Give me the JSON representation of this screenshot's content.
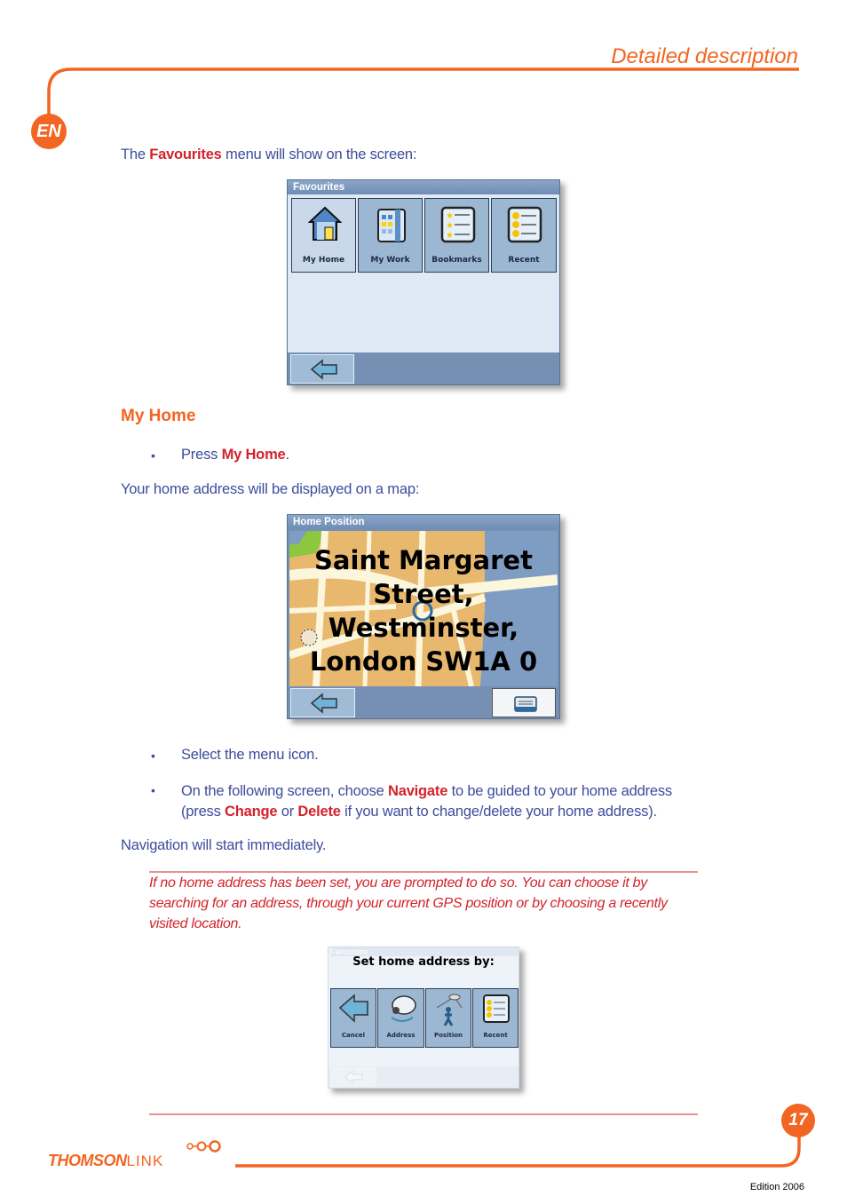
{
  "header": {
    "section_title": "Detailed description",
    "language_badge": "EN"
  },
  "intro": {
    "prefix": "The ",
    "bold": "Favourites",
    "suffix": " menu will show on the screen:"
  },
  "favourites_screen": {
    "title": "Favourites",
    "tiles": [
      {
        "label": "My Home",
        "icon": "house-icon"
      },
      {
        "label": "My Work",
        "icon": "office-building-icon"
      },
      {
        "label": "Bookmarks",
        "icon": "bookmarks-list-icon"
      },
      {
        "label": "Recent",
        "icon": "recent-list-icon"
      }
    ],
    "back_icon": "back-arrow-icon"
  },
  "my_home": {
    "heading": "My Home",
    "bullet1_prefix": "Press ",
    "bullet1_bold": "My Home",
    "bullet1_suffix": ".",
    "map_intro": "Your home address will be displayed on a map:"
  },
  "home_position_screen": {
    "title": "Home Position",
    "address_lines": [
      "Saint Margaret",
      "Street,",
      "Westminster,",
      "London SW1A 0"
    ],
    "back_icon": "back-arrow-icon",
    "menu_icon": "menu-icon",
    "colors": {
      "land": "#e8b86e",
      "water": "#7f9cc3",
      "road": "#fbf6dc",
      "park": "#8dc63f"
    }
  },
  "steps": {
    "bullet2": "Select the menu icon.",
    "bullet3_part1": "On the following screen, choose ",
    "bullet3_bold1": "Navigate",
    "bullet3_part2": " to be guided to your home address",
    "bullet3_part3": "(press ",
    "bullet3_bold2": "Change",
    "bullet3_part4": " or ",
    "bullet3_bold3": "Delete",
    "bullet3_part5": " if you want to change/delete your home address).",
    "after": "Navigation will start immediately."
  },
  "note": {
    "text": "If no home address has been set, you are prompted to do so. You can choose it by searching for an address, through your current GPS position or by choosing a recently visited location."
  },
  "set_home_screen": {
    "faded_title": "Favourites",
    "prompt": "Set home address by:",
    "tiles": [
      {
        "label": "Cancel",
        "icon": "back-arrow-icon"
      },
      {
        "label": "Address",
        "icon": "satellite-dish-icon"
      },
      {
        "label": "Position",
        "icon": "gps-person-icon"
      },
      {
        "label": "Recent",
        "icon": "recent-list-icon"
      }
    ]
  },
  "footer": {
    "brand": "THOMSON",
    "brand_suffix": "LINK",
    "page_number": "17",
    "edition": "Edition 2006"
  },
  "colors": {
    "accent_orange": "#f26522",
    "emphasis_red": "#d2232a",
    "body_navy": "#3d4c9c"
  }
}
